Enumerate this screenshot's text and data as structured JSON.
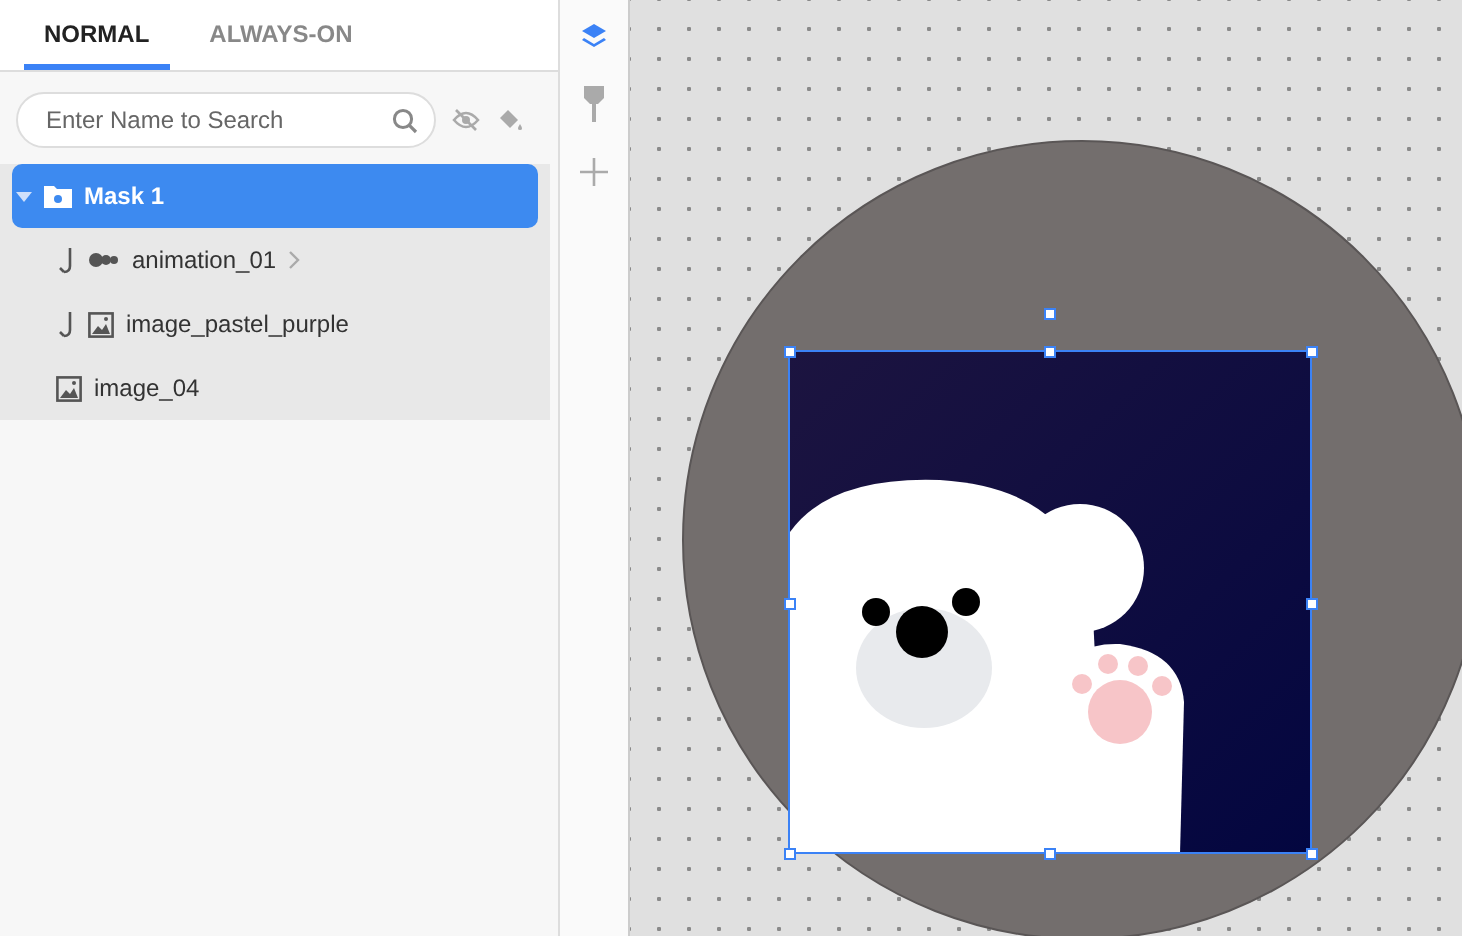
{
  "tabs": [
    {
      "label": "NORMAL",
      "selected": true
    },
    {
      "label": "ALWAYS-ON",
      "selected": false
    }
  ],
  "search": {
    "placeholder": "Enter Name to Search"
  },
  "layers": [
    {
      "kind": "mask",
      "name": "Mask 1",
      "selected": true,
      "expanded": true,
      "clipped": false,
      "children": [
        {
          "kind": "animation",
          "name": "animation_01",
          "selected": false,
          "clipped": true,
          "has_children": true
        },
        {
          "kind": "image",
          "name": "image_pastel_purple",
          "selected": false,
          "clipped": true,
          "has_children": false
        }
      ]
    },
    {
      "kind": "image",
      "name": "image_04",
      "selected": false,
      "clipped": false,
      "has_children": false
    }
  ],
  "tools": [
    {
      "kind": "layers",
      "selected": true
    },
    {
      "kind": "pin",
      "selected": false
    },
    {
      "kind": "add",
      "selected": false
    }
  ]
}
